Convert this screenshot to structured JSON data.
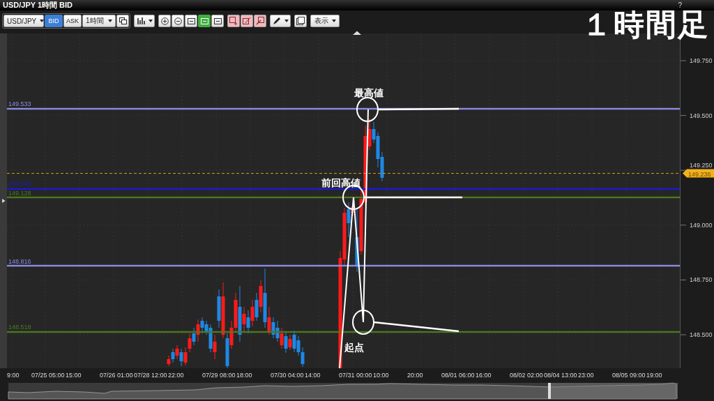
{
  "window": {
    "title": "USD/JPY 1時間 BID",
    "help": "?"
  },
  "overlay_title": "１時間足",
  "toolbar": {
    "symbol": "USD/JPY",
    "price_types": [
      {
        "label": "BID",
        "selected": true
      },
      {
        "label": "ASK",
        "selected": false
      }
    ],
    "timeframe": "1時間",
    "view_tools": [
      {
        "on": false
      },
      {
        "on": false
      },
      {
        "on": false
      },
      {
        "on": true
      },
      {
        "on": false
      }
    ],
    "view_menu": "表示"
  },
  "chart": {
    "levels": [
      {
        "label": "149.533",
        "color": "#8c8ce6"
      },
      {
        "label": "149.143",
        "color": "#1a1ad0"
      },
      {
        "label": "149.128",
        "color": "#4a7a1e"
      },
      {
        "label": "148.816",
        "color": "#8c8ce6"
      },
      {
        "label": "148.518",
        "color": "#4a7a1e"
      }
    ],
    "current_price": "149.236",
    "price_axis": [
      "149.750",
      "149.500",
      "149.250",
      "149.000",
      "148.750",
      "148.500"
    ],
    "time_axis": [
      "9:00",
      "07/25 05:00",
      "15:00",
      "07/26 01:00",
      "07/28 12:00",
      "22:00",
      "07/29 08:00",
      "18:00",
      "07/30 04:00",
      "14:00",
      "07/31 00:00",
      "10:00",
      "20:00",
      "08/01 06:00",
      "16:00",
      "08/02 02:00",
      "08/04 13:00",
      "23:00",
      "08/05 09:00",
      "19:00"
    ],
    "annotations": [
      "最高値",
      "前回高値",
      "起点"
    ]
  }
}
